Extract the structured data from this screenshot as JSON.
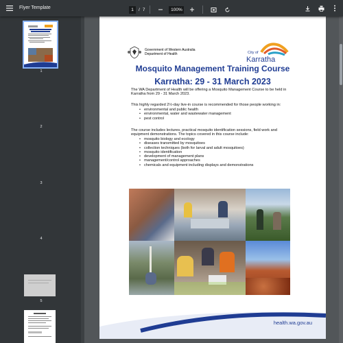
{
  "toolbar": {
    "doc_title": "Flyer Template",
    "page_current": "1",
    "page_sep": "/",
    "page_total": "7",
    "zoom": "100%",
    "icons": [
      "menu-icon",
      "zoom-out-icon",
      "zoom-in-icon",
      "fit-page-icon",
      "rotate-icon",
      "download-icon",
      "print-icon",
      "more-icon"
    ]
  },
  "sidebar": {
    "pages": [
      {
        "label": "1"
      },
      {
        "label": "2"
      },
      {
        "label": "3"
      },
      {
        "label": "4"
      },
      {
        "label": "5"
      }
    ]
  },
  "flyer": {
    "gov_line1": "Government of Western Australia",
    "gov_line2": "Department of Health",
    "city_small": "City of",
    "city_name": "Karratha",
    "title_line1": "Mosquito Management Training Course",
    "title_line2": "Karratha: 29 - 31 March 2023",
    "intro": "The WA Department of Health will be offering a Mosquito Management Course to be held in Karratha from 29 - 31 March 2023.",
    "recommended": "This highly regarded 2½-day live-in course is recommended for those people working in:",
    "audience": [
      "environmental and public health",
      "environmental, water and wastewater management",
      "pest control"
    ],
    "includes": "The course includes lectures, practical mosquito identification sessions, field work and equipment demonstrations. The topics covered in this course include:",
    "topics": [
      "mosquito biology and ecology",
      "diseases transmitted by mosquitoes",
      "collection techniques (both for larval and adult mosquitoes)",
      "mosquito identification",
      "development of management plans",
      "management/control approaches",
      "chemicals and equipment including displays and demonstrations"
    ],
    "footer_url": "health.wa.gov.au"
  },
  "colors": {
    "title_blue": "#1f3c93",
    "toolbar_bg": "#323639",
    "viewer_bg": "#525659"
  }
}
